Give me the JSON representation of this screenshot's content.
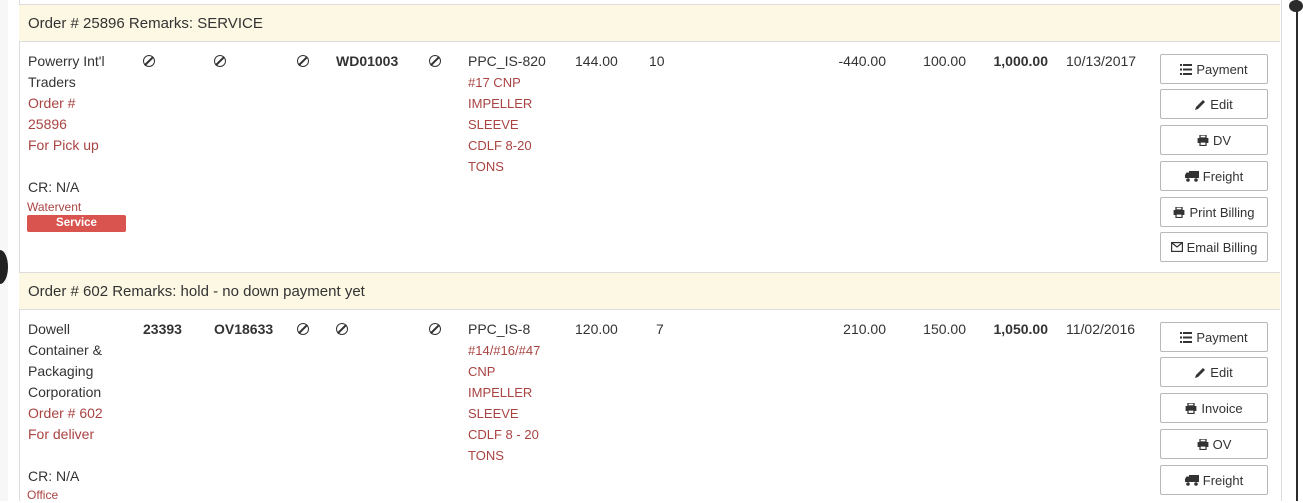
{
  "orders": [
    {
      "header": "Order # 25896 Remarks: SERVICE",
      "customer_lines": [
        "Powerry Int'l",
        "Traders"
      ],
      "order_lines": [
        "Order #",
        "25896",
        "For Pick up"
      ],
      "cr": "CR: N/A",
      "location": "Watervent",
      "badge": "Service",
      "col2": "",
      "col3": "",
      "wd": "WD01003",
      "part": "PPC_IS-820",
      "desc_lines": [
        "#17 CNP",
        "IMPELLER",
        "SLEEVE",
        "CDLF 8-20",
        "TONS"
      ],
      "price": "144.00",
      "qty": "10",
      "adjust": "-440.00",
      "discount": "100.00",
      "total": "1,000.00",
      "date": "10/13/2017",
      "buttons": [
        {
          "icon": "list-icon",
          "label": "Payment"
        },
        {
          "icon": "pencil-icon",
          "label": "Edit"
        },
        {
          "icon": "print-icon",
          "label": "DV"
        },
        {
          "icon": "truck-icon",
          "label": "Freight"
        },
        {
          "icon": "print-icon",
          "label": "Print Billing"
        },
        {
          "icon": "envelope-icon",
          "label": "Email Billing"
        }
      ]
    },
    {
      "header": "Order # 602 Remarks: hold - no down payment yet",
      "customer_lines": [
        "Dowell",
        "Container &",
        "Packaging",
        "Corporation"
      ],
      "order_lines": [
        "Order # 602",
        "For deliver"
      ],
      "cr": "CR: N/A",
      "location": "Office",
      "col2": "23393",
      "col3": "OV18633",
      "wd": "",
      "part": "PPC_IS-8",
      "desc_lines": [
        "#14/#16/#47",
        "CNP",
        "IMPELLER",
        "SLEEVE",
        "CDLF 8 - 20",
        "TONS"
      ],
      "price": "120.00",
      "qty": "7",
      "adjust": "210.00",
      "discount": "150.00",
      "total": "1,050.00",
      "date": "11/02/2016",
      "buttons": [
        {
          "icon": "list-icon",
          "label": "Payment"
        },
        {
          "icon": "pencil-icon",
          "label": "Edit"
        },
        {
          "icon": "print-icon",
          "label": "Invoice"
        },
        {
          "icon": "print-icon",
          "label": "OV"
        },
        {
          "icon": "truck-icon",
          "label": "Freight"
        }
      ]
    }
  ]
}
